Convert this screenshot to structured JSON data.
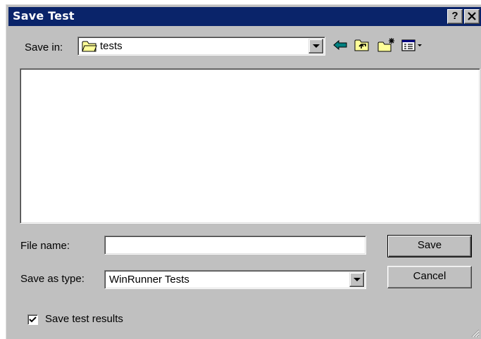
{
  "title_bar": {
    "title": "Save Test",
    "help_label": "?",
    "close_label": "✕"
  },
  "save_in": {
    "label": "Save in:",
    "value": "tests",
    "icon": "folder-icon"
  },
  "toolbar": {
    "icons": [
      "back-arrow-icon",
      "up-one-level-icon",
      "new-folder-icon",
      "view-menu-icon"
    ]
  },
  "file_list": {
    "items": []
  },
  "file_name": {
    "label": "File name:",
    "value": ""
  },
  "save_as_type": {
    "label": "Save as type:",
    "value": "WinRunner Tests"
  },
  "buttons": {
    "save": "Save",
    "cancel": "Cancel"
  },
  "save_results": {
    "label": "Save test results",
    "checked": true
  },
  "colors": {
    "titlebar": "#0a246a",
    "face": "#c0c0c0",
    "folder": "#ffff99",
    "arrow": "#008080"
  }
}
